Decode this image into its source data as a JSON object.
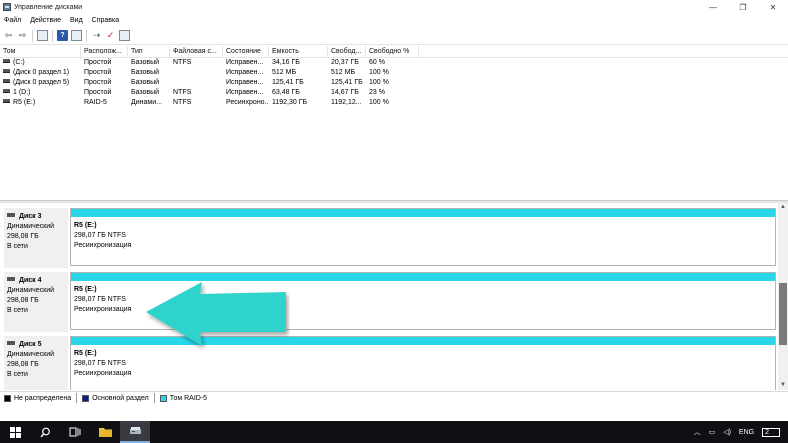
{
  "window": {
    "title": "Управление дисками",
    "minimize": "—",
    "maximize": "❐",
    "close": "✕"
  },
  "menu": [
    "Файл",
    "Действие",
    "Вид",
    "Справка"
  ],
  "table": {
    "headers": [
      "Том",
      "Располож...",
      "Тип",
      "Файловая с...",
      "Состояние",
      "Емкость",
      "Свобод...",
      "Свободно %"
    ],
    "rows": [
      [
        "(C:)",
        "Простой",
        "Базовый",
        "NTFS",
        "Исправен...",
        "34,16 ГБ",
        "20,37 ГБ",
        "60 %"
      ],
      [
        "(Диск 0 раздел 1)",
        "Простой",
        "Базовый",
        "",
        "Исправен...",
        "512 МБ",
        "512 МБ",
        "100 %"
      ],
      [
        "(Диск 0 раздел 5)",
        "Простой",
        "Базовый",
        "",
        "Исправен...",
        "125,41 ГБ",
        "125,41 ГБ",
        "100 %"
      ],
      [
        "1 (D:)",
        "Простой",
        "Базовый",
        "NTFS",
        "Исправен...",
        "63,48 ГБ",
        "14,67 ГБ",
        "23 %"
      ],
      [
        "R5 (E:)",
        "RAID-5",
        "Динами...",
        "NTFS",
        "Ресинхроно...",
        "1192,30 ГБ",
        "1192,12...",
        "100 %"
      ]
    ]
  },
  "disks": [
    {
      "name": "Диск 3",
      "type": "Динамический",
      "size": "298,08 ГБ",
      "status": "В сети",
      "part_name": "R5  (E:)",
      "part_size": "298,07 ГБ NTFS",
      "part_status": "Ресинхронизация"
    },
    {
      "name": "Диск 4",
      "type": "Динамический",
      "size": "298,08 ГБ",
      "status": "В сети",
      "part_name": "R5  (E:)",
      "part_size": "298,07 ГБ NTFS",
      "part_status": "Ресинхронизация"
    },
    {
      "name": "Диск 5",
      "type": "Динамический",
      "size": "298,08 ГБ",
      "status": "В сети",
      "part_name": "R5  (E:)",
      "part_size": "298,07 ГБ NTFS",
      "part_status": "Ресинхронизация"
    }
  ],
  "legend": [
    {
      "label": "Не распределена",
      "color": "#000000"
    },
    {
      "label": "Основной раздел",
      "color": "#0a1e8c"
    },
    {
      "label": "Том RAID-5",
      "color": "#28d7ea"
    }
  ],
  "colors": {
    "raid_band": "#28d7ea",
    "arrow": "#2fd3cc"
  },
  "taskbar": {
    "language": "ENG",
    "notification_count": "2"
  }
}
